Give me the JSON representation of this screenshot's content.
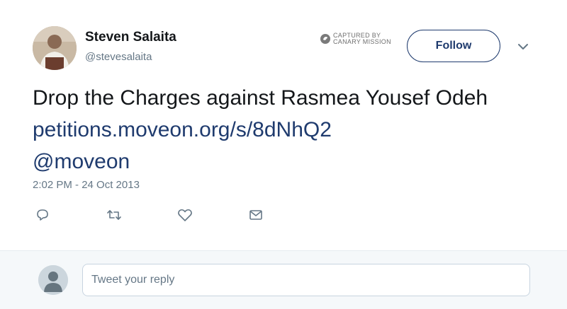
{
  "author": {
    "name": "Steven Salaita",
    "handle": "@stevesalaita"
  },
  "watermark": {
    "line1": "CAPTURED BY",
    "line2": "CANARY MISSION"
  },
  "follow_label": "Follow",
  "tweet": {
    "text_plain": "Drop the Charges against Rasmea Yousef Odeh",
    "link": "petitions.moveon.org/s/8dNhQ2",
    "mention": "@moveon",
    "timestamp": "2:02 PM - 24 Oct 2013"
  },
  "actions": [
    {
      "icon": "reply-icon"
    },
    {
      "icon": "retweet-icon"
    },
    {
      "icon": "like-icon"
    },
    {
      "icon": "direct-message-icon"
    }
  ],
  "reply": {
    "placeholder": "Tweet your reply"
  },
  "colors": {
    "link": "#1f3b6e",
    "secondary_text": "#657786",
    "reply_bar_bg": "#f5f8fa"
  }
}
